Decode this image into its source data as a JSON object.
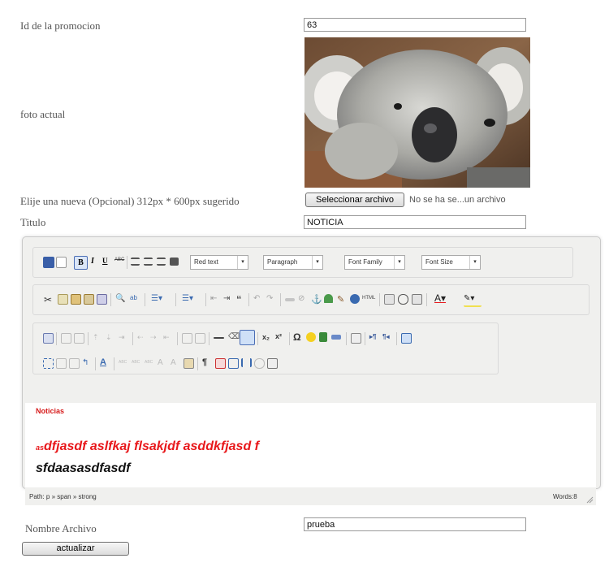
{
  "form": {
    "id_label": "Id de la promocion",
    "id_value": "63",
    "photo_label": "foto actual",
    "file_label": "Elije una nueva (Opcional) 312px * 600px sugerido",
    "file_button": "Seleccionar archivo",
    "file_status": "No se ha se...un archivo",
    "title_label": "Titulo",
    "title_value": "NOTICIA",
    "filename_label": "Nombre Archivo",
    "filename_value": "prueba",
    "submit_label": "actualizar"
  },
  "editor": {
    "dropdowns": {
      "style": "Red text",
      "format": "Paragraph",
      "font_family": "Font Family",
      "font_size": "Font Size"
    },
    "content": {
      "heading": "Noticias",
      "small_prefix": "as",
      "line1": "dfjasdf aslfkaj flsakjdf asddkfjasd f",
      "line2": "sfdaasasdfasdf"
    },
    "path": "Path: p » span » strong",
    "words": "Words:8",
    "font_color_letter": "A"
  },
  "colors": {
    "red_text": "#e8181b",
    "heading_red": "#d61a1a"
  }
}
